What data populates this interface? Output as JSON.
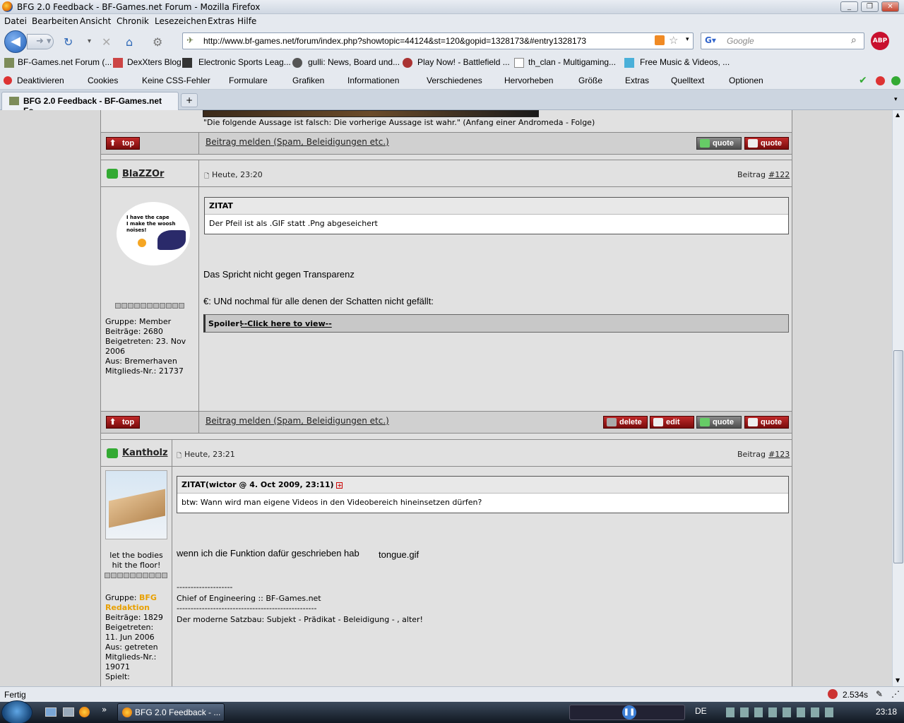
{
  "window": {
    "title": "BFG 2.0 Feedback - BF-Games.net Forum - Mozilla Firefox"
  },
  "menu": [
    "Datei",
    "Bearbeiten",
    "Ansicht",
    "Chronik",
    "Lesezeichen",
    "Extras",
    "Hilfe"
  ],
  "url": "http://www.bf-games.net/forum/index.php?showtopic=44124&st=120&gopid=1328173&#entry1328173",
  "search_placeholder": "Google",
  "abp": "ABP",
  "bookmarks": [
    "BF-Games.net Forum (...",
    "DexXters Blog",
    "Electronic Sports Leag...",
    "gulli: News, Board und...",
    "Play Now! - Battlefield ...",
    "th_clan - Multigaming...",
    "Free Music & Videos, ..."
  ],
  "webdev": [
    "Deaktivieren",
    "Cookies",
    "Keine CSS-Fehler",
    "Formulare",
    "Grafiken",
    "Informationen",
    "Verschiedenes",
    "Hervorheben",
    "Größe",
    "Extras",
    "Quelltext",
    "Optionen"
  ],
  "tab": {
    "title": "BFG 2.0 Feedback - BF-Games.net Fo..."
  },
  "prev_signature": "\"Die folgende Aussage ist falsch: Die vorherige Aussage ist wahr.\" (Anfang einer Andromeda - Folge)",
  "buttons": {
    "top": "top",
    "quote1": "quote",
    "quote2": "quote",
    "delete": "delete",
    "edit": "edit"
  },
  "report_label": "Beitrag melden (Spam, Beleidigungen etc.)",
  "post1": {
    "user": "BlaZZOr",
    "time": "Heute, 23:20",
    "beitrag": "Beitrag",
    "num": "#122",
    "avatar_text": "I have the cape\nI make the woosh\nnoises!",
    "info": [
      "Gruppe: Member",
      "Beiträge: 2680",
      "Beigetreten: 23. Nov",
      "2006",
      "Aus: Bremerhaven",
      "Mitglieds-Nr.: 21737"
    ],
    "quote_header": "ZITAT",
    "quote_body": "Der Pfeil ist als .GIF statt .Png abgeseichert",
    "text1": "Das Spricht nicht gegen Transparenz",
    "text2": "€: UNd nochmal für alle denen der Schatten nicht gefällt:",
    "spoiler_label": "Spoiler!",
    "spoiler_link": "--Click here to view--"
  },
  "post2": {
    "user": "Kantholz",
    "time": "Heute, 23:21",
    "beitrag": "Beitrag",
    "num": "#123",
    "motto": [
      "let the bodies",
      "hit the floor!"
    ],
    "group_label": "Gruppe:",
    "group_value": "BFG",
    "group_value2": "Redaktion",
    "info": [
      "Beiträge: 1829",
      "Beigetreten:",
      "11. Jun 2006",
      "Aus: getreten",
      "Mitglieds-Nr.:",
      "19071",
      "Spielt:"
    ],
    "quote_header": "ZITAT(wictor @ 4. Oct 2009, 23:11)",
    "quote_body": "btw: Wann wird man eigene Videos in den Videobereich hineinsetzen dürfen?",
    "text1": "wenn ich die Funktion dafür geschrieben hab",
    "smiley_alt": "tongue.gif",
    "sig_sep1": "--------------------",
    "sig_line1": "Chief of Engineering :: BF-Games.net",
    "sig_sep2": "--------------------------------------------------",
    "sig_line2": "Der moderne Satzbau: Subjekt - Prädikat - Beleidigung - , alter!"
  },
  "status": {
    "text": "Fertig",
    "time": "2.534s"
  },
  "taskbar": {
    "button": "BFG 2.0 Feedback - ...",
    "lang": "DE",
    "clock": "23:18"
  }
}
